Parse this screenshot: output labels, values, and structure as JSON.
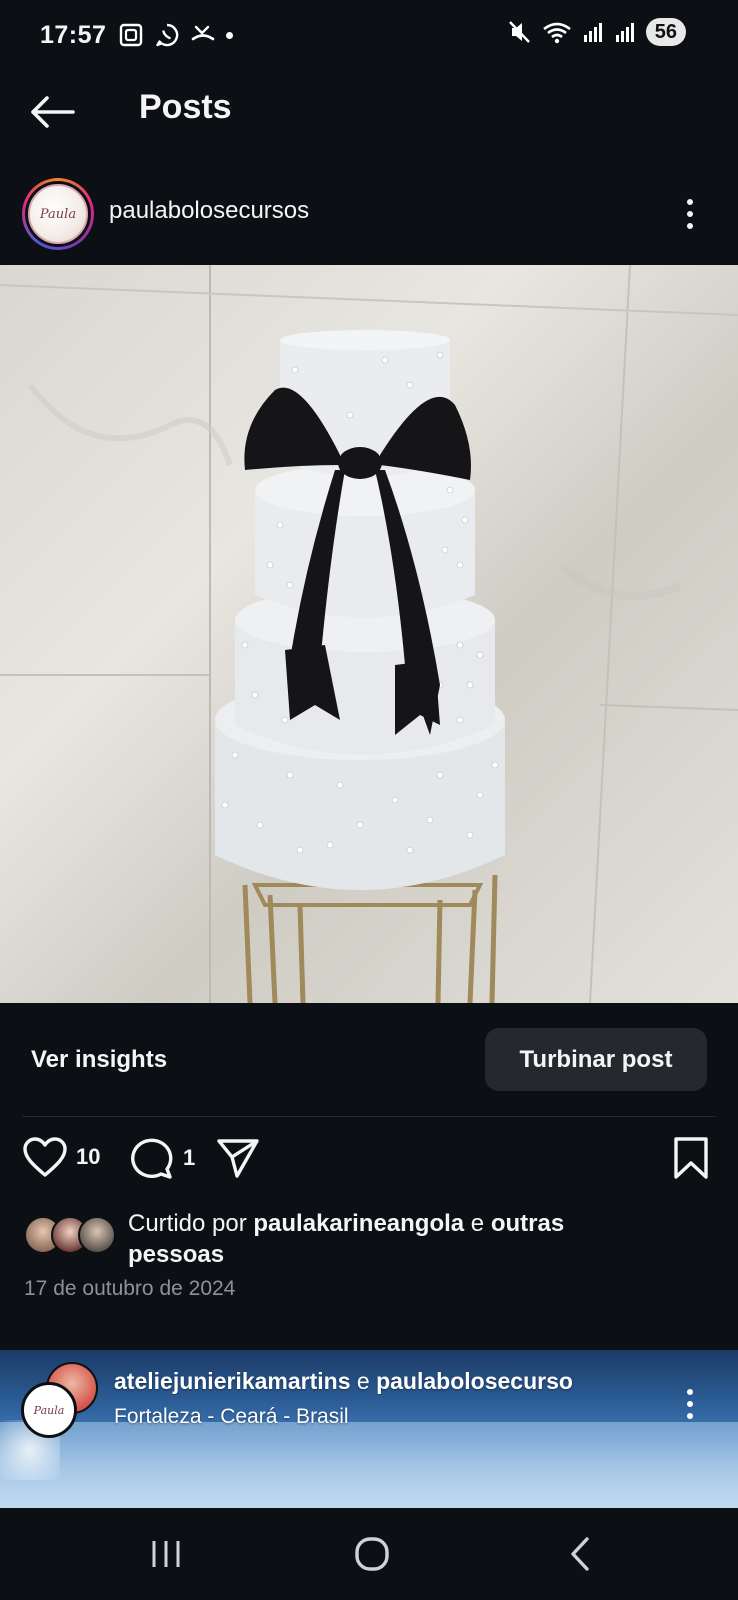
{
  "status_bar": {
    "time": "17:57",
    "battery": "56",
    "left_icons": [
      "screenshot-icon",
      "whatsapp-icon",
      "missed-call-icon",
      "notification-dot"
    ],
    "right_icons": [
      "mute-icon",
      "wifi-icon",
      "signal-icon",
      "signal-icon"
    ]
  },
  "header": {
    "title": "Posts"
  },
  "post": {
    "username": "paulabolosecursos",
    "avatar_text": "Paula",
    "insights_label": "Ver insights",
    "boost_label": "Turbinar post",
    "like_count": "10",
    "comment_count": "1",
    "likes_prefix": "Curtido por ",
    "likes_user": "paulakarineangola",
    "likes_middle": " e ",
    "likes_others": "outras",
    "likes_suffix": "pessoas",
    "date": "17 de outubro de 2024"
  },
  "next_post": {
    "user_a": "ateliejunierikamartins",
    "joiner": " e ",
    "user_b": "paulabolosecurso",
    "location": "Fortaleza - Ceará - Brasil",
    "avatar_text": "Paula"
  },
  "nav": {
    "buttons": [
      "recent-apps",
      "home",
      "back"
    ]
  },
  "colors": {
    "background": "#0c1014",
    "button_bg": "#25292e",
    "muted_text": "#8e9196"
  }
}
